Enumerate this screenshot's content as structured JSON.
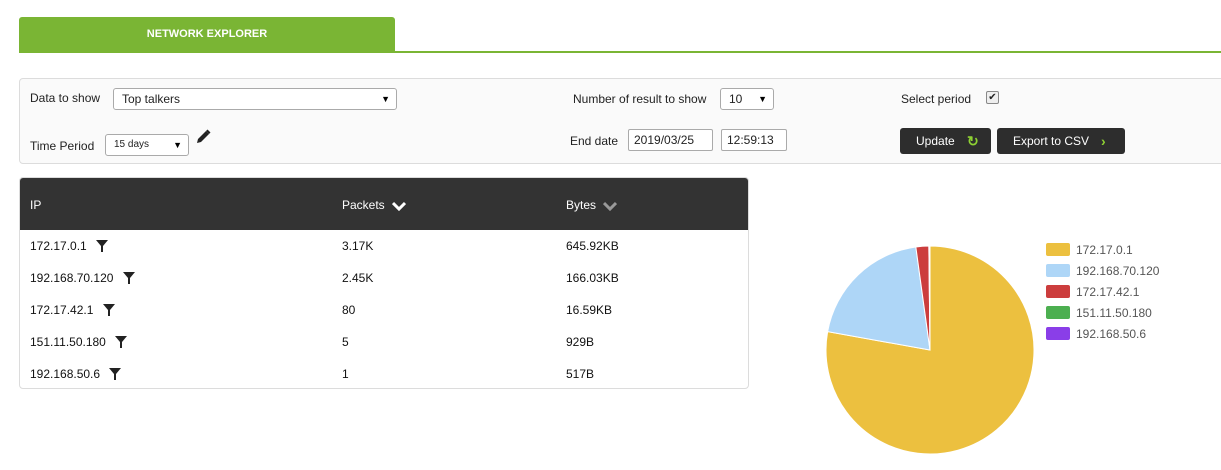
{
  "tab": {
    "label": "NETWORK EXPLORER"
  },
  "filters": {
    "data_to_show_label": "Data to show",
    "data_to_show_value": "Top talkers",
    "number_results_label": "Number of result to show",
    "number_results_value": "10",
    "select_period_label": "Select period",
    "select_period_checked": "✔",
    "time_period_label": "Time Period",
    "time_period_value": "15 days",
    "end_date_label": "End date",
    "end_date_value": "2019/03/25",
    "end_time_value": "12:59:13",
    "update_label": "Update",
    "export_label": "Export to CSV"
  },
  "table": {
    "headers": {
      "ip": "IP",
      "packets": "Packets",
      "bytes": "Bytes"
    },
    "rows": [
      {
        "ip": "172.17.0.1",
        "packets": "3.17K",
        "bytes": "645.92KB"
      },
      {
        "ip": "192.168.70.120",
        "packets": "2.45K",
        "bytes": "166.03KB"
      },
      {
        "ip": "172.17.42.1",
        "packets": "80",
        "bytes": "16.59KB"
      },
      {
        "ip": "151.11.50.180",
        "packets": "5",
        "bytes": "929B"
      },
      {
        "ip": "192.168.50.6",
        "packets": "1",
        "bytes": "517B"
      }
    ]
  },
  "chart_data": {
    "type": "pie",
    "categories": [
      "172.17.0.1",
      "192.168.70.120",
      "172.17.42.1",
      "151.11.50.180",
      "192.168.50.6"
    ],
    "values": [
      645.92,
      166.03,
      16.59,
      0.929,
      0.517
    ],
    "colors": [
      "#ecc03f",
      "#aed6f7",
      "#cc3d3d",
      "#4caf50",
      "#8a3ee8"
    ],
    "legend_placement": "right"
  }
}
